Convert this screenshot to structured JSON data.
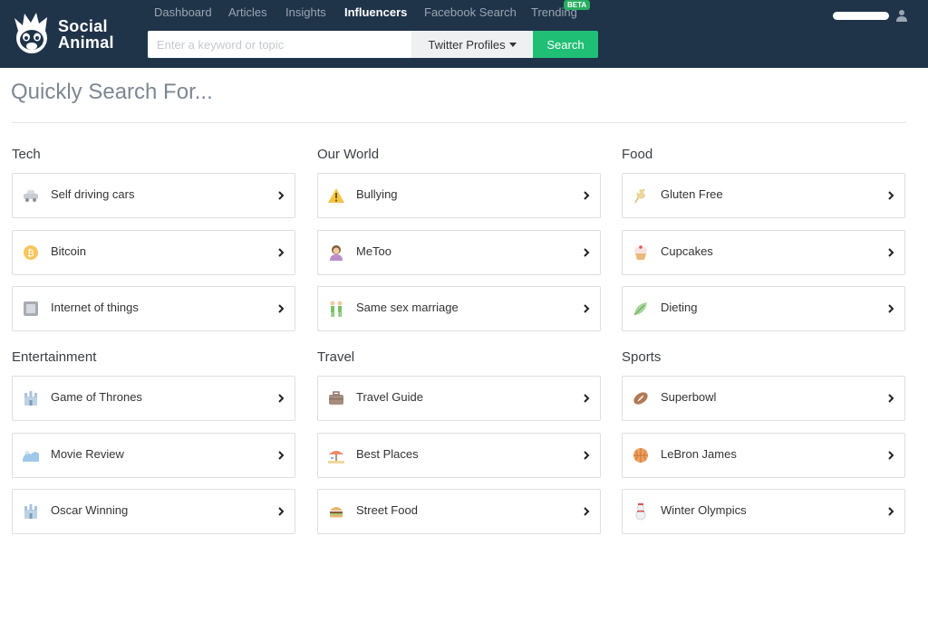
{
  "brand": {
    "line1": "Social",
    "line2": "Animal"
  },
  "nav": {
    "items": [
      {
        "label": "Dashboard",
        "active": false
      },
      {
        "label": "Articles",
        "active": false
      },
      {
        "label": "Insights",
        "active": false
      },
      {
        "label": "Influencers",
        "active": true
      },
      {
        "label": "Facebook Search",
        "active": false
      },
      {
        "label": "Trending",
        "active": false
      }
    ],
    "beta_badge": "BETA"
  },
  "search": {
    "placeholder": "Enter a keyword or topic",
    "value": "",
    "type_selected": "Twitter Profiles",
    "button_label": "Search"
  },
  "page": {
    "title": "Quickly Search For..."
  },
  "categories": [
    {
      "title": "Tech",
      "items": [
        {
          "label": "Self driving cars",
          "icon": "car-icon"
        },
        {
          "label": "Bitcoin",
          "icon": "bitcoin-icon"
        },
        {
          "label": "Internet of things",
          "icon": "device-icon"
        }
      ]
    },
    {
      "title": "Our World",
      "items": [
        {
          "label": "Bullying",
          "icon": "warning-icon"
        },
        {
          "label": "MeToo",
          "icon": "woman-icon"
        },
        {
          "label": "Same sex marriage",
          "icon": "couple-icon"
        }
      ]
    },
    {
      "title": "Food",
      "items": [
        {
          "label": "Gluten Free",
          "icon": "wheat-icon"
        },
        {
          "label": "Cupcakes",
          "icon": "cupcake-icon"
        },
        {
          "label": "Dieting",
          "icon": "leaf-icon"
        }
      ]
    },
    {
      "title": "Entertainment",
      "items": [
        {
          "label": "Game of Thrones",
          "icon": "castle-icon"
        },
        {
          "label": "Movie Review",
          "icon": "film-icon"
        },
        {
          "label": "Oscar Winning",
          "icon": "castle-icon"
        }
      ]
    },
    {
      "title": "Travel",
      "items": [
        {
          "label": "Travel Guide",
          "icon": "briefcase-icon"
        },
        {
          "label": "Best Places",
          "icon": "beach-icon"
        },
        {
          "label": "Street Food",
          "icon": "burger-icon"
        }
      ]
    },
    {
      "title": "Sports",
      "items": [
        {
          "label": "Superbowl",
          "icon": "football-icon"
        },
        {
          "label": "LeBron James",
          "icon": "basketball-icon"
        },
        {
          "label": "Winter Olympics",
          "icon": "snowman-icon"
        }
      ]
    }
  ]
}
